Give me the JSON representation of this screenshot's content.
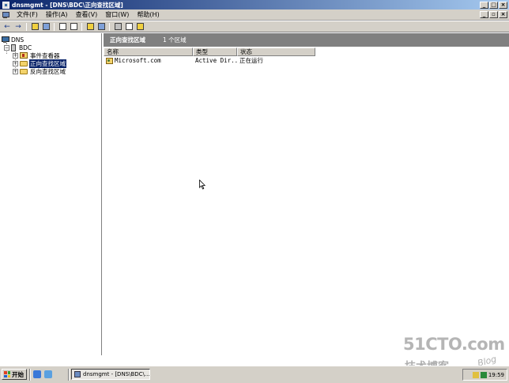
{
  "window": {
    "title": "dnsmgmt - [DNS\\BDC\\正向查找区域]"
  },
  "menu": {
    "items": [
      "文件(F)",
      "操作(A)",
      "查看(V)",
      "窗口(W)",
      "帮助(H)"
    ]
  },
  "tree": {
    "root": "DNS",
    "server": "BDC",
    "children": [
      "事件查看器",
      "正向查找区域",
      "反向查找区域"
    ],
    "selected_index": 1
  },
  "pane": {
    "title": "正向查找区域",
    "count": "1 个区域",
    "columns": [
      "名称",
      "类型",
      "状态"
    ],
    "rows": [
      {
        "name": "Microsoft.com",
        "type": "Active Dir...",
        "status": "正在运行"
      }
    ]
  },
  "taskbar": {
    "start_label": "开始",
    "task_label": "dnsmgmt - [DNS\\BDC\\...",
    "clock": "19:59"
  },
  "watermark": {
    "site": "51CTO.com",
    "slogan": "技术博客",
    "blog": "Blog"
  },
  "colors": {
    "titlebar_start": "#0a246a",
    "titlebar_end": "#a6caf0",
    "chrome": "#d4d0c8",
    "selection": "#0a246a"
  },
  "icons": {
    "app": "dns-console-icon",
    "start": "windows-flag-icon"
  }
}
